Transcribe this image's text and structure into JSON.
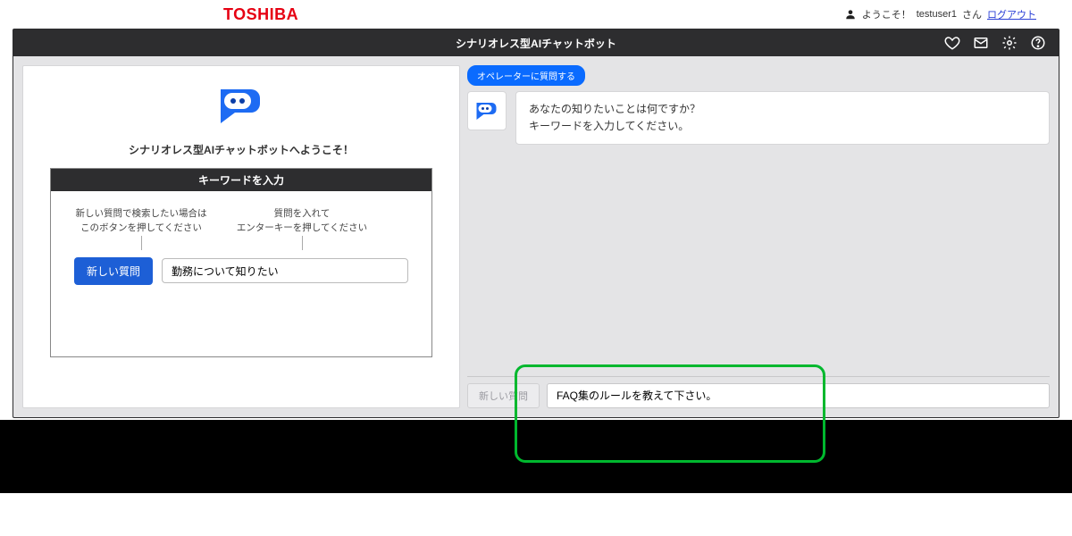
{
  "header": {
    "brand": "TOSHIBA",
    "welcome_prefix": "ようこそ！",
    "username": "testuser1",
    "welcome_suffix": "さん",
    "logout": "ログアウト"
  },
  "app": {
    "title": "シナリオレス型AIチャットボット",
    "icons": {
      "heart": "heart-icon",
      "mail": "mail-icon",
      "gear": "gear-icon",
      "help": "help-icon"
    }
  },
  "left": {
    "welcome": "シナリオレス型AIチャットボットへようこそ！",
    "keyword_title": "キーワードを入力",
    "hint1_line1": "新しい質問で検索したい場合は",
    "hint1_line2": "このボタンを押してください",
    "hint2_line1": "質問を入れて",
    "hint2_line2": "エンターキーを押してください",
    "new_question_btn": "新しい質問",
    "keyword_value": "勤務について知りたい"
  },
  "right": {
    "operator_pill": "オペレーターに質問する",
    "bot_msg_line1": "あなたの知りたいことは何ですか？",
    "bot_msg_line2": "キーワードを入力してください。",
    "new_question_btn": "新しい質問",
    "chat_input_value": "FAQ集のルールを教えて下さい。"
  }
}
